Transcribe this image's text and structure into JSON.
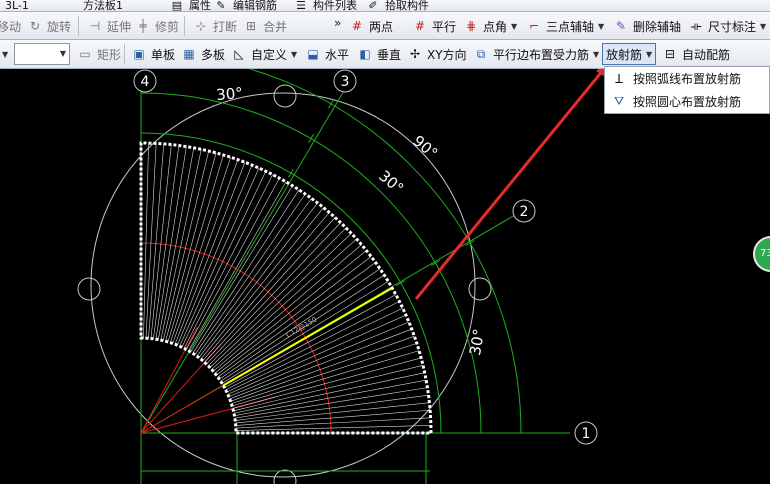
{
  "toolbar_top": {
    "items": [
      {
        "label": "3L-1",
        "icon": "none"
      },
      {
        "label": "方法板1",
        "icon": "none"
      },
      {
        "label": "属性",
        "icon": "properties-icon"
      },
      {
        "label": "编辑钢筋",
        "icon": "edit-rebar-icon"
      },
      {
        "label": "构件列表",
        "icon": "component-list-icon"
      },
      {
        "label": "拾取构件",
        "icon": "pick-component-icon"
      }
    ]
  },
  "toolbar_edit": {
    "items": [
      {
        "label": "移动",
        "icon": "move-icon",
        "enabled": false
      },
      {
        "label": "旋转",
        "icon": "rotate-icon",
        "enabled": false
      },
      {
        "label": "延伸",
        "icon": "extend-icon",
        "enabled": false
      },
      {
        "label": "修剪",
        "icon": "trim-icon",
        "enabled": false
      },
      {
        "label": "打断",
        "icon": "break-icon",
        "enabled": false
      },
      {
        "label": "合并",
        "icon": "merge-icon",
        "enabled": false
      },
      {
        "label": "两点",
        "icon": "two-point-icon",
        "enabled": true
      },
      {
        "label": "平行",
        "icon": "parallel-icon",
        "enabled": true
      },
      {
        "label": "点角",
        "icon": "point-angle-icon",
        "enabled": true
      },
      {
        "label": "三点辅轴",
        "icon": "three-point-axis-icon",
        "enabled": true
      },
      {
        "label": "删除辅轴",
        "icon": "delete-axis-icon",
        "enabled": true
      },
      {
        "label": "尺寸标注",
        "icon": "dimension-icon",
        "enabled": true
      }
    ]
  },
  "toolbar_draw": {
    "combo_value": "",
    "items": [
      {
        "label": "矩形",
        "icon": "rectangle-icon",
        "enabled": false
      },
      {
        "label": "单板",
        "icon": "single-slab-icon",
        "enabled": true
      },
      {
        "label": "多板",
        "icon": "multi-slab-icon",
        "enabled": true
      },
      {
        "label": "自定义",
        "icon": "custom-icon",
        "enabled": true
      },
      {
        "label": "水平",
        "icon": "horizontal-icon",
        "enabled": true
      },
      {
        "label": "垂直",
        "icon": "vertical-icon",
        "enabled": true
      },
      {
        "label": "XY方向",
        "icon": "xy-direction-icon",
        "enabled": true
      },
      {
        "label": "平行边布置受力筋",
        "icon": "parallel-edge-rebar-icon",
        "enabled": true
      },
      {
        "label": "放射筋",
        "icon": "radial-rebar-icon",
        "enabled": true
      },
      {
        "label": "自动配筋",
        "icon": "auto-rebar-icon",
        "enabled": true
      }
    ]
  },
  "dropdown_menu": {
    "items": [
      {
        "label": "按照弧线布置放射筋",
        "icon": "arc-radial-icon"
      },
      {
        "label": "按照圆心布置放射筋",
        "icon": "center-radial-icon"
      }
    ]
  },
  "drawing": {
    "axis_labels": [
      "4",
      "3",
      "2",
      "1"
    ],
    "angle_labels": [
      "30°",
      "90°",
      "30°",
      "30°"
    ],
    "rebar_text": "C12@150",
    "colors": {
      "axis_green": "#1fae1f",
      "slab_outline": "#ffffff",
      "rebar_lines": "#ffffff",
      "selected_rebar": "#ffff00",
      "red_construction": "#e01818",
      "arrow": "#e52b2b",
      "grid_circle": "#c8c8c8"
    }
  },
  "side_widget": {
    "label": "73"
  }
}
